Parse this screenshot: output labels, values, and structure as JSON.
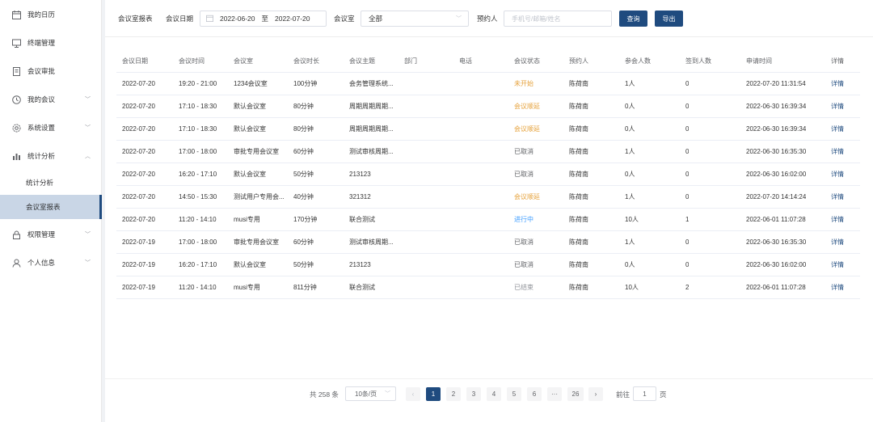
{
  "sidebar": {
    "items": [
      {
        "label": "我的日历",
        "icon": "calendar-icon"
      },
      {
        "label": "终端管理",
        "icon": "monitor-icon"
      },
      {
        "label": "会议审批",
        "icon": "document-icon"
      },
      {
        "label": "我的会议",
        "icon": "clock-icon"
      },
      {
        "label": "系统设置",
        "icon": "gear-icon"
      },
      {
        "label": "统计分析",
        "icon": "bar-chart-icon"
      },
      {
        "label": "权限管理",
        "icon": "lock-icon"
      },
      {
        "label": "个人信息",
        "icon": "user-icon"
      }
    ],
    "sub_items": [
      {
        "label": "统计分析"
      },
      {
        "label": "会议室报表"
      }
    ]
  },
  "filter": {
    "report_title": "会议室报表",
    "date_label": "会议日期",
    "date_start": "2022-06-20",
    "date_sep": "至",
    "date_end": "2022-07-20",
    "room_label": "会议室",
    "room_value": "全部",
    "booker_label": "预约人",
    "booker_placeholder": "手机号/邮箱/姓名",
    "query_label": "查询",
    "export_label": "导出"
  },
  "table": {
    "headers": [
      "会议日期",
      "会议时间",
      "会议室",
      "会议时长",
      "会议主题",
      "部门",
      "电话",
      "会议状态",
      "预约人",
      "参会人数",
      "签到人数",
      "申请时间",
      "详情"
    ],
    "rows": [
      [
        "2022-07-20",
        "19:20 - 21:00",
        "1234会议室",
        "100分钟",
        "会务管理系统...",
        "",
        "",
        "未开始",
        "陈荷南",
        "1人",
        "0",
        "2022-07-20 11:31:54",
        "详情"
      ],
      [
        "2022-07-20",
        "17:10 - 18:30",
        "默认会议室",
        "80分钟",
        "周期周期周期...",
        "",
        "",
        "会议顺延",
        "陈荷南",
        "0人",
        "0",
        "2022-06-30 16:39:34",
        "详情"
      ],
      [
        "2022-07-20",
        "17:10 - 18:30",
        "默认会议室",
        "80分钟",
        "周期周期周期...",
        "",
        "",
        "会议顺延",
        "陈荷南",
        "0人",
        "0",
        "2022-06-30 16:39:34",
        "详情"
      ],
      [
        "2022-07-20",
        "17:00 - 18:00",
        "审批专用会议室",
        "60分钟",
        "测试审核周期...",
        "",
        "",
        "已取消",
        "陈荷南",
        "1人",
        "0",
        "2022-06-30 16:35:30",
        "详情"
      ],
      [
        "2022-07-20",
        "16:20 - 17:10",
        "默认会议室",
        "50分钟",
        "213123",
        "",
        "",
        "已取消",
        "陈荷南",
        "0人",
        "0",
        "2022-06-30 16:02:00",
        "详情"
      ],
      [
        "2022-07-20",
        "14:50 - 15:30",
        "测试用户专用会...",
        "40分钟",
        "321312",
        "",
        "",
        "会议顺延",
        "陈荷南",
        "1人",
        "0",
        "2022-07-20 14:14:24",
        "详情"
      ],
      [
        "2022-07-20",
        "11:20 - 14:10",
        "musi专用",
        "170分钟",
        "联合测试",
        "",
        "",
        "进行中",
        "陈荷南",
        "10人",
        "1",
        "2022-06-01 11:07:28",
        "详情"
      ],
      [
        "2022-07-19",
        "17:00 - 18:00",
        "审批专用会议室",
        "60分钟",
        "测试审核周期...",
        "",
        "",
        "已取消",
        "陈荷南",
        "1人",
        "0",
        "2022-06-30 16:35:30",
        "详情"
      ],
      [
        "2022-07-19",
        "16:20 - 17:10",
        "默认会议室",
        "50分钟",
        "213123",
        "",
        "",
        "已取消",
        "陈荷南",
        "0人",
        "0",
        "2022-06-30 16:02:00",
        "详情"
      ],
      [
        "2022-07-19",
        "11:20 - 14:10",
        "musi专用",
        "811分钟",
        "联合测试",
        "",
        "",
        "已结束",
        "陈荷南",
        "10人",
        "2",
        "2022-06-01 11:07:28",
        "详情"
      ]
    ],
    "status_colors": {
      "未开始": "#e6a23c",
      "会议顺延": "#e6a23c",
      "进行中": "#409eff",
      "已取消": "#606266",
      "已结束": "#909399"
    }
  },
  "pagination": {
    "total_text": "共 258 条",
    "page_size": "10条/页",
    "pages": [
      "1",
      "2",
      "3",
      "4",
      "5",
      "6",
      "···",
      "26"
    ],
    "current": "1",
    "prev_symbol": "‹",
    "next_symbol": "›",
    "goto_label": "前往",
    "goto_value": "1",
    "goto_unit": "页"
  },
  "colors": {
    "accent": "#1f4b7f",
    "active_menu_bg": "#c9d6e6"
  }
}
